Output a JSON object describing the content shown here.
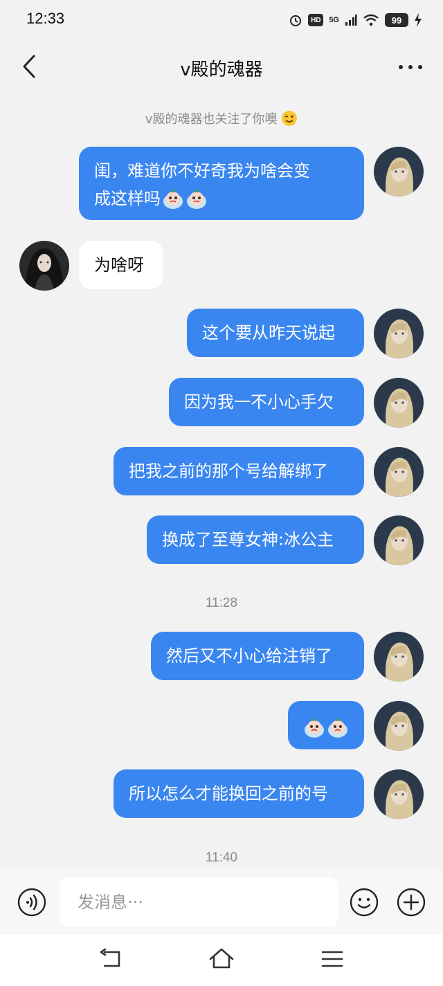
{
  "status_bar": {
    "time": "12:33",
    "network": "5G",
    "hd": "HD",
    "battery": "99"
  },
  "header": {
    "title": "v殿的魂器"
  },
  "notice": {
    "text": "v殿的魂器也关注了你噢",
    "emoji": "wink-emoji"
  },
  "messages": [
    {
      "side": "out",
      "line1": "闺，难道你不好奇我为啥会变",
      "line2": "成这样吗"
    },
    {
      "side": "in",
      "text": "为啥呀"
    },
    {
      "side": "out",
      "text": "这个要从昨天说起"
    },
    {
      "side": "out",
      "text": "因为我一不小心手欠"
    },
    {
      "side": "out",
      "text": "把我之前的那个号给解绑了"
    },
    {
      "side": "out",
      "text": "换成了至尊女神:冰公主"
    },
    {
      "side": "out",
      "text": "然后又不小心给注销了"
    },
    {
      "side": "out",
      "text": "",
      "sticker": "crying-emoji"
    },
    {
      "side": "out",
      "text": "所以怎么才能换回之前的号"
    }
  ],
  "timestamps": [
    "11:28",
    "11:40"
  ],
  "input_bar": {
    "placeholder": "发消息···"
  },
  "colors": {
    "bubble_out": "#3a86f0",
    "bubble_in": "#ffffff",
    "background": "#f2f2f2"
  }
}
